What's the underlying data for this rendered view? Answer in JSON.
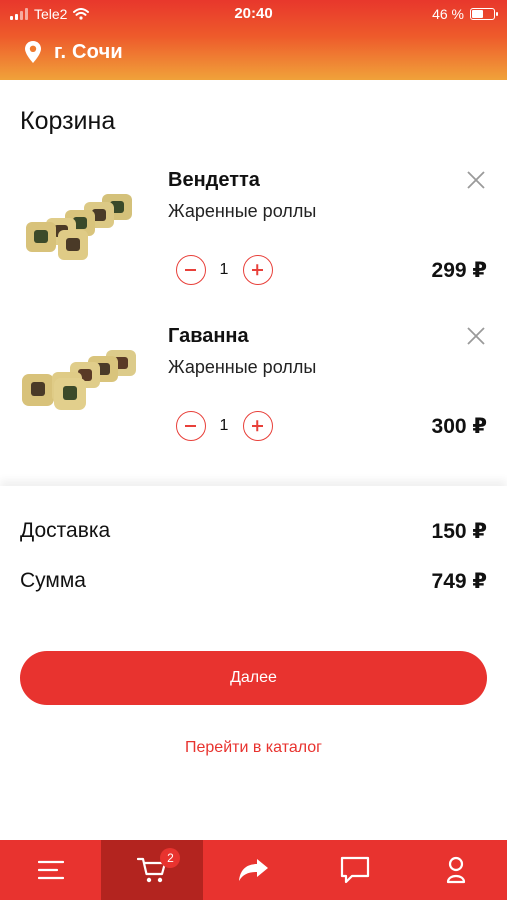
{
  "status_bar": {
    "carrier": "Tele2",
    "time": "20:40",
    "battery_text": "46 %",
    "battery_level_percent": 46
  },
  "header": {
    "city": "г. Сочи",
    "location_icon": "location-pin-icon",
    "colors": {
      "top": "#e8372c",
      "bottom": "#f0a23a"
    }
  },
  "cart": {
    "title": "Корзина",
    "items": [
      {
        "name": "Вендетта",
        "category": "Жаренные роллы",
        "quantity": "1",
        "price": "299 ₽"
      },
      {
        "name": "Гаванна",
        "category": "Жаренные роллы",
        "quantity": "1",
        "price": "300 ₽"
      }
    ]
  },
  "summary": {
    "delivery_label": "Доставка",
    "delivery_value": "150 ₽",
    "total_label": "Сумма",
    "total_value": "749 ₽",
    "next_button": "Далее",
    "catalog_link": "Перейти в каталог"
  },
  "bottom_nav": {
    "items": [
      {
        "icon": "menu-icon"
      },
      {
        "icon": "cart-icon",
        "badge": "2",
        "active": true
      },
      {
        "icon": "share-arrow-icon"
      },
      {
        "icon": "chat-icon"
      },
      {
        "icon": "profile-icon"
      }
    ],
    "colors": {
      "background": "#e8332f",
      "active": "#b3241f"
    }
  }
}
